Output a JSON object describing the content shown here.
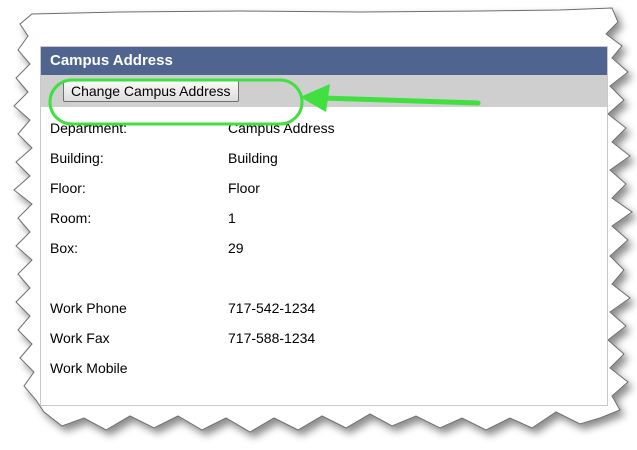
{
  "panel": {
    "title": "Campus Address",
    "change_button_label": "Change Campus Address"
  },
  "address_fields": [
    {
      "label": "Department:",
      "value": "Campus Address"
    },
    {
      "label": "Building:",
      "value": "Building"
    },
    {
      "label": "Floor:",
      "value": "Floor"
    },
    {
      "label": "Room:",
      "value": "1"
    },
    {
      "label": "Box:",
      "value": "29"
    }
  ],
  "contact_fields": [
    {
      "label": "Work Phone",
      "value": "717-542-1234"
    },
    {
      "label": "Work Fax",
      "value": "717-588-1234"
    },
    {
      "label": "Work Mobile",
      "value": ""
    }
  ],
  "colors": {
    "header_bg": "#4f6590",
    "toolbar_bg": "#cfcfcf",
    "highlight": "#3fe03f"
  }
}
